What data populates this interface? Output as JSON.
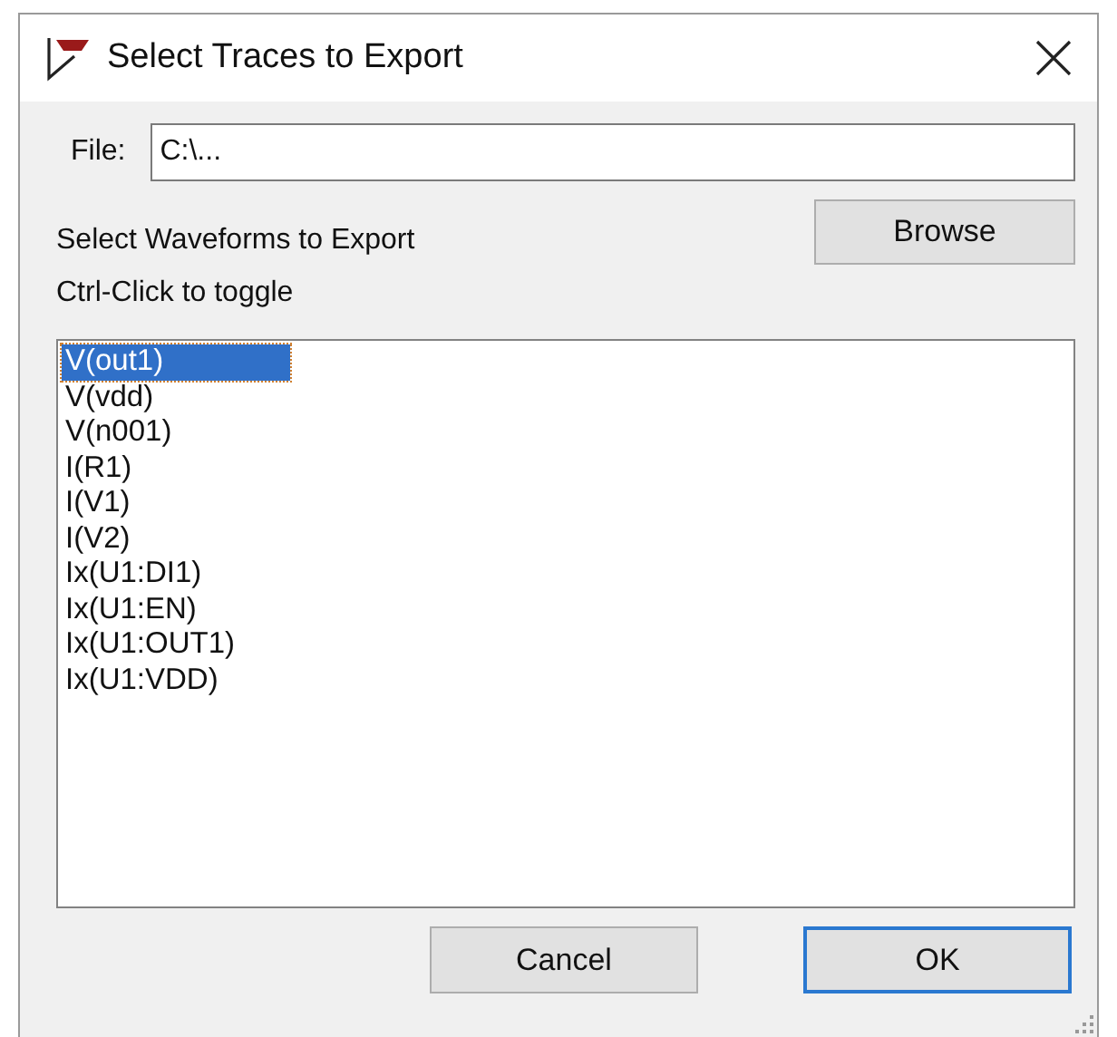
{
  "window": {
    "title": "Select Traces to Export"
  },
  "file": {
    "label": "File:",
    "value": "C:\\..."
  },
  "browse_button": {
    "label": "Browse"
  },
  "instructions": [
    "Select Waveforms to Export",
    "Ctrl-Click to toggle"
  ],
  "traces": [
    {
      "label": "V(out1)",
      "selected": true
    },
    {
      "label": "V(vdd)",
      "selected": false
    },
    {
      "label": "V(n001)",
      "selected": false
    },
    {
      "label": "I(R1)",
      "selected": false
    },
    {
      "label": "I(V1)",
      "selected": false
    },
    {
      "label": "I(V2)",
      "selected": false
    },
    {
      "label": "Ix(U1:DI1)",
      "selected": false
    },
    {
      "label": "Ix(U1:EN)",
      "selected": false
    },
    {
      "label": "Ix(U1:OUT1)",
      "selected": false
    },
    {
      "label": "Ix(U1:VDD)",
      "selected": false
    }
  ],
  "buttons": [
    {
      "label": "Cancel",
      "default": false
    },
    {
      "label": "OK",
      "default": true
    }
  ]
}
